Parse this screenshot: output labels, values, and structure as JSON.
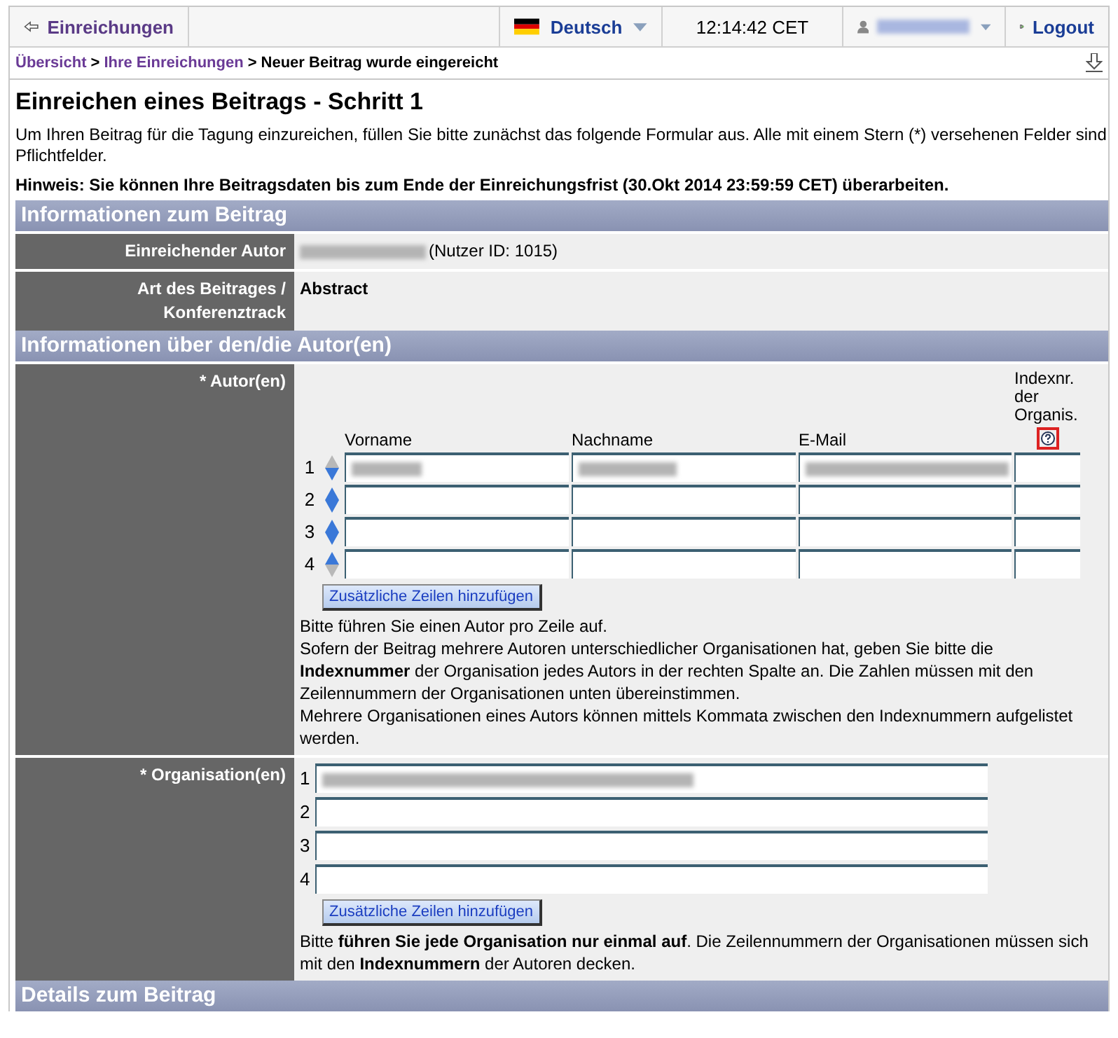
{
  "topbar": {
    "back": "Einreichungen",
    "language": "Deutsch",
    "time": "12:14:42 CET",
    "user_blurred": true,
    "logout": "Logout"
  },
  "breadcrumb": {
    "items": [
      "Übersicht",
      "Ihre Einreichungen"
    ],
    "separators": [
      ">",
      ">"
    ],
    "current": "Neuer Beitrag wurde eingereicht"
  },
  "title": "Einreichen eines Beitrags - Schritt 1",
  "intro": "Um Ihren Beitrag für die Tagung einzureichen, füllen Sie bitte zunächst das folgende Formular aus. Alle mit einem Stern (*) versehenen Felder sind Pflichtfelder.",
  "notice": "Hinweis: Sie können Ihre Beitragsdaten bis zum Ende der Einreichungsfrist (30.Okt 2014 23:59:59 CET) überarbeiten.",
  "section1": {
    "title": "Informationen zum Beitrag",
    "rows": [
      {
        "label": "Einreichender Autor",
        "name_blurred": true,
        "value": "(Nutzer ID: 1015)"
      },
      {
        "label": "Art des Beitrages / Konferenztrack",
        "name_blurred": false,
        "value": "Abstract"
      }
    ]
  },
  "section2": {
    "title": "Informationen über den/die Autor(en)",
    "authors": {
      "label": "* Autor(en)",
      "columns": [
        "Vorname",
        "Nachname",
        "E-Mail",
        "Indexnr. der Organis."
      ],
      "rows": [
        {
          "number": "1",
          "can_move_up": false,
          "can_move_down": true,
          "filled": true
        },
        {
          "number": "2",
          "can_move_up": true,
          "can_move_down": true,
          "filled": false
        },
        {
          "number": "3",
          "can_move_up": true,
          "can_move_down": true,
          "filled": false
        },
        {
          "number": "4",
          "can_move_up": true,
          "can_move_down": false,
          "filled": false
        }
      ],
      "add_button": "Zusätzliche Zeilen hinzufügen",
      "help": [
        "Bitte führen Sie einen Autor pro Zeile auf.",
        "Sofern der Beitrag mehrere Autoren unterschiedlicher Organisationen hat, geben Sie bitte die **Indexnummer** der Organisation jedes Autors in der rechten Spalte an. Die Zahlen müssen mit den Zeilennummern der Organisationen unten übereinstimmen.",
        "Mehrere Organisationen eines Autors können mittels Kommata zwischen den Indexnummern aufgelistet werden."
      ]
    },
    "organisations": {
      "label": "* Organisation(en)",
      "rows": [
        {
          "number": "1",
          "filled": true
        },
        {
          "number": "2",
          "filled": false
        },
        {
          "number": "3",
          "filled": false
        },
        {
          "number": "4",
          "filled": false
        }
      ],
      "add_button": "Zusätzliche Zeilen hinzufügen",
      "help": "Bitte **führen Sie jede Organisation nur einmal auf**. Die Zeilennummern der Organisationen müssen sich mit den **Indexnummern** der Autoren decken."
    }
  },
  "section3": {
    "title": "Details zum Beitrag"
  }
}
